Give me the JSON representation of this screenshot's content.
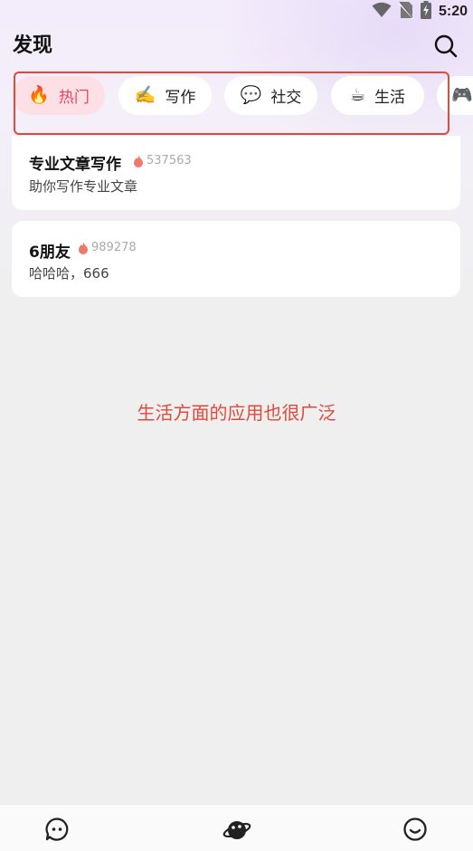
{
  "status_bar": {
    "time": "5:20",
    "icons": [
      "wifi-icon",
      "no-sim-icon",
      "battery-charging-icon"
    ]
  },
  "header": {
    "title": "发现",
    "search_icon": "search-icon"
  },
  "tabs": [
    {
      "emoji": "🔥",
      "label": "热门",
      "active": true
    },
    {
      "emoji": "✍️",
      "label": "写作",
      "active": false
    },
    {
      "emoji": "💬",
      "label": "社交",
      "active": false
    },
    {
      "emoji": "☕",
      "label": "生活",
      "active": false
    },
    {
      "emoji": "🎮",
      "label": "",
      "active": false
    }
  ],
  "cards": [
    {
      "title": "专业文章写作",
      "hot_count": "537563",
      "description": "助你写作专业文章"
    },
    {
      "title": "6朋友",
      "hot_count": "989278",
      "description": "哈哈哈，666"
    }
  ],
  "annotation": "生活方面的应用也很广泛",
  "colors": {
    "accent": "#e8455e",
    "annotation": "#e04a3a",
    "active_tab_bg": "#fde0e6"
  },
  "bottom_nav": [
    {
      "icon": "chat-bubble-icon"
    },
    {
      "icon": "planet-icon",
      "active": true
    },
    {
      "icon": "smiley-icon"
    }
  ]
}
